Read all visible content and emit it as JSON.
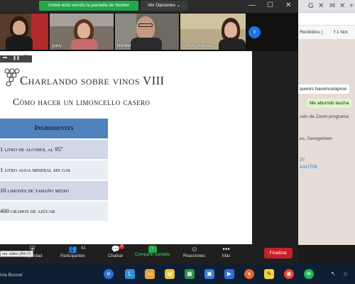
{
  "share_banner": "Usted está viendo la pantalla de Norber",
  "view_options": "Ver Opciones ⌄",
  "window_controls": {
    "minimize": "—",
    "maximize": "☐",
    "close": "✕"
  },
  "participants": [
    {
      "name": ""
    },
    {
      "name": "gaby"
    },
    {
      "name": "Norber"
    },
    {
      "name": "Dorys Quinta..."
    }
  ],
  "next_icon": "›",
  "mini_controls": {
    "a": "▬",
    "b": "❚❚",
    "c": "⬛"
  },
  "slide": {
    "title": "Charlando sobre vinos VIII",
    "subtitle": "Cómo hacer un limoncello casero",
    "table_header": "Ingredientes",
    "rows": [
      "1 litro de alcohol al 95º",
      "1 litro agua mineral sin gas",
      "10 limones de tamaño medio",
      "400 gramos de azúcar"
    ]
  },
  "toolbar": {
    "tooltip": "ner video (Alt+V)",
    "seguridad": "Seguridad",
    "participantes": "Participantes",
    "participant_count": "41",
    "chatear": "Chatear",
    "chat_badge": "2",
    "compartir": "Compartir pantalla",
    "reacciones": "Reacciones",
    "mas": "Más",
    "finalizar": "Finalizar"
  },
  "browser": {
    "bookmark1": "Recibidos (",
    "bookmark2": "1 Not"
  },
  "chat": {
    "msg1": "querés hacemoslaprue",
    "msg2": "Me aburrido lascha",
    "msg3": "sión de Zoom programa",
    "msg4": "es, Georgetown",
    "msg5": "37",
    "msg6": "AXUT09"
  },
  "taskbar": {
    "label": "ivia Buscar"
  },
  "colors": {
    "banner_green": "#23a84a",
    "table_header": "#4f81bd",
    "finalizar_red": "#c8202a"
  }
}
